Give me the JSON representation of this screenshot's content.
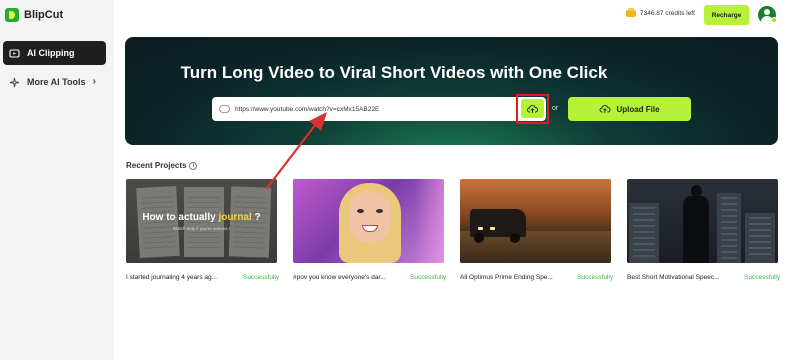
{
  "brand": {
    "name": "BlipCut"
  },
  "sidebar": {
    "items": [
      {
        "label": "AI Clipping",
        "icon": "clip-icon",
        "active": true
      },
      {
        "label": "More AI Tools",
        "icon": "sparkle-icon",
        "active": false
      }
    ]
  },
  "header": {
    "credits_text": "7346.87 credits left",
    "recharge_label": "Recharge"
  },
  "hero": {
    "title": "Turn Long Video to Viral Short Videos with One Click",
    "url_value": "https://www.youtube.com/watch?v=cxMx15AB22E",
    "or_text": "or",
    "upload_label": "Upload File"
  },
  "recent": {
    "title": "Recent Projects",
    "projects": [
      {
        "title": "I started journaling 4 years ag...",
        "status": "Successfully",
        "thumb_caption_pre": "How to actually ",
        "thumb_caption_highlight": "journal",
        "thumb_caption_post": " ?",
        "thumb_sub": "Watch only if you're serious !"
      },
      {
        "title": "#pov you know everyone's dar...",
        "status": "Successfully"
      },
      {
        "title": "All Optimus Prime Ending Spe...",
        "status": "Successfully"
      },
      {
        "title": "Best Short Motivational Speec...",
        "status": "Successfully"
      }
    ]
  },
  "colors": {
    "accent": "#b7f23a",
    "success": "#3bb54a",
    "highlight_border": "#e11c1c",
    "annotation_arrow": "#d9312d"
  }
}
